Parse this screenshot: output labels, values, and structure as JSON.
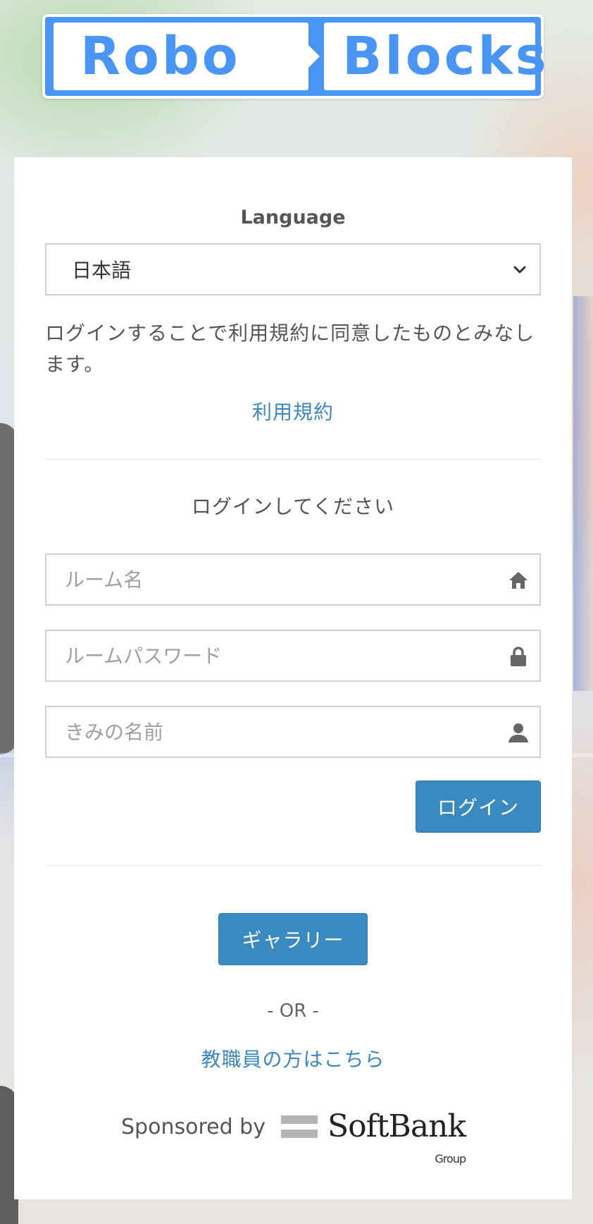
{
  "logo": {
    "left_word": "Robo",
    "right_word": "Blocks",
    "color": "#4895f5"
  },
  "language": {
    "label": "Language",
    "selected": "日本語"
  },
  "terms": {
    "notice": "ログインすることで利用規約に同意したものとみなします。",
    "link_label": "利用規約"
  },
  "login": {
    "prompt": "ログインしてください",
    "room_placeholder": "ルーム名",
    "password_placeholder": "ルームパスワード",
    "name_placeholder": "きみの名前",
    "button_label": "ログイン"
  },
  "gallery": {
    "button_label": "ギャラリー"
  },
  "or_text": "- OR -",
  "staff_link": "教職員の方はこちら",
  "sponsor": {
    "label": "Sponsored by",
    "company": "SoftBank",
    "sub": "Group"
  },
  "colors": {
    "accent": "#3a8ac2",
    "link": "#3a87c2"
  },
  "icons": {
    "room": "home-icon",
    "password": "lock-icon",
    "name": "user-icon",
    "select": "chevron-down-icon"
  }
}
